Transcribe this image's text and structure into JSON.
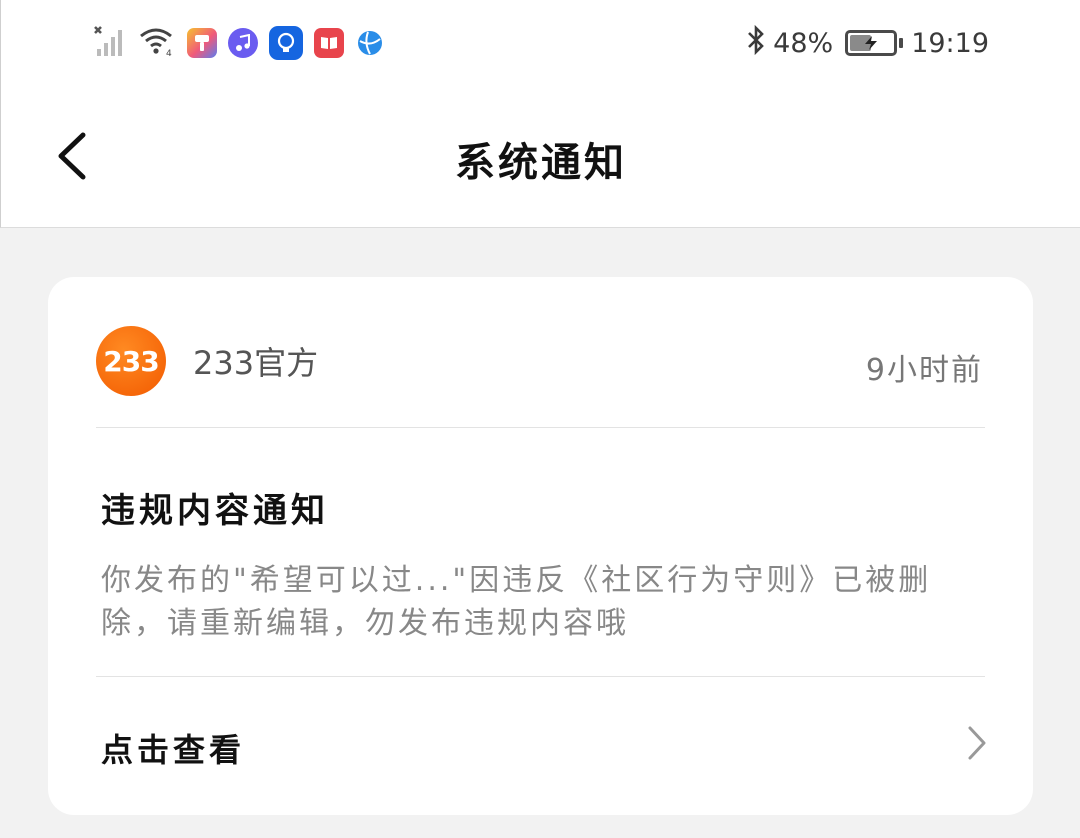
{
  "status_bar": {
    "bluetooth": "bluetooth-icon",
    "battery_percent": "48%",
    "battery_level": 0.48,
    "time": "19:19",
    "icons": [
      "signal-icon",
      "wifi-icon",
      "paint-app-icon",
      "music-app-icon",
      "bulb-app-icon",
      "book-app-icon",
      "browser-app-icon"
    ]
  },
  "header": {
    "title": "系统通知",
    "back_icon": "back-arrow-icon"
  },
  "notification": {
    "avatar_text": "233",
    "sender": "233官方",
    "time": "9小时前",
    "title": "违规内容通知",
    "body": "你发布的\"希望可以过...\"因违反《社区行为守则》已被删除，请重新编辑，勿发布违规内容哦",
    "action_label": "点击查看",
    "action_icon": "chevron-right-icon"
  },
  "colors": {
    "accent": "#f26b0f",
    "background": "#f2f2f2",
    "card": "#ffffff"
  }
}
